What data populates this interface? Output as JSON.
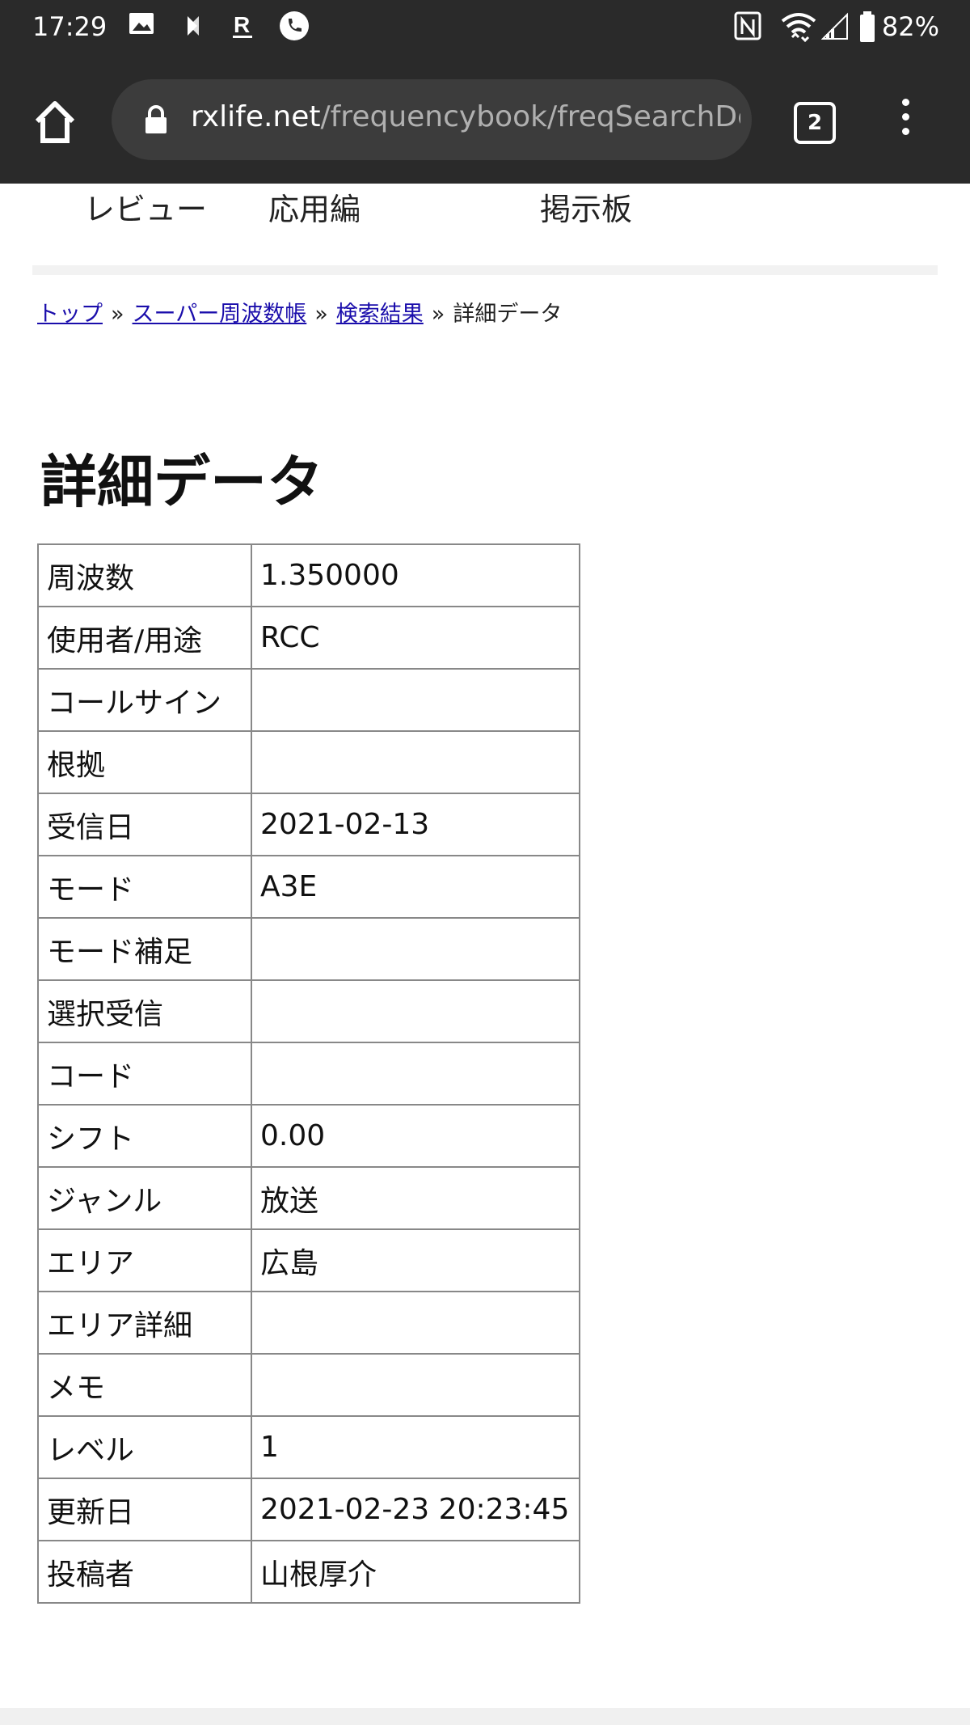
{
  "status_bar": {
    "time": "17:29",
    "left_icons": [
      "image-icon",
      "sync-icon",
      "r-app-icon",
      "phone-icon"
    ],
    "right_icons": [
      "nfc-icon",
      "wifi-icon",
      "signal-icon",
      "battery-icon"
    ],
    "battery": "82%"
  },
  "browser": {
    "url_domain": "rxlife.net",
    "url_path": "/frequencybook/freqSearchDe",
    "tab_count": "2"
  },
  "site_nav": {
    "items": [
      "レビュー",
      "応用編",
      "掲示板"
    ]
  },
  "breadcrumb": {
    "items": [
      "トップ",
      "スーパー周波数帳",
      "検索結果"
    ],
    "current": "詳細データ",
    "separator": "»"
  },
  "page_title": "詳細データ",
  "details": [
    {
      "label": "周波数",
      "value": "1.350000"
    },
    {
      "label": "使用者/用途",
      "value": "RCC"
    },
    {
      "label": "コールサイン",
      "value": ""
    },
    {
      "label": "根拠",
      "value": ""
    },
    {
      "label": "受信日",
      "value": "2021-02-13"
    },
    {
      "label": "モード",
      "value": "A3E"
    },
    {
      "label": "モード補足",
      "value": ""
    },
    {
      "label": "選択受信",
      "value": ""
    },
    {
      "label": "コード",
      "value": ""
    },
    {
      "label": "シフト",
      "value": "0.00"
    },
    {
      "label": "ジャンル",
      "value": "放送"
    },
    {
      "label": "エリア",
      "value": "広島"
    },
    {
      "label": "エリア詳細",
      "value": ""
    },
    {
      "label": "メモ",
      "value": ""
    },
    {
      "label": "レベル",
      "value": "1"
    },
    {
      "label": "更新日",
      "value": "2021-02-23 20:23:45"
    },
    {
      "label": "投稿者",
      "value": "山根厚介"
    }
  ]
}
